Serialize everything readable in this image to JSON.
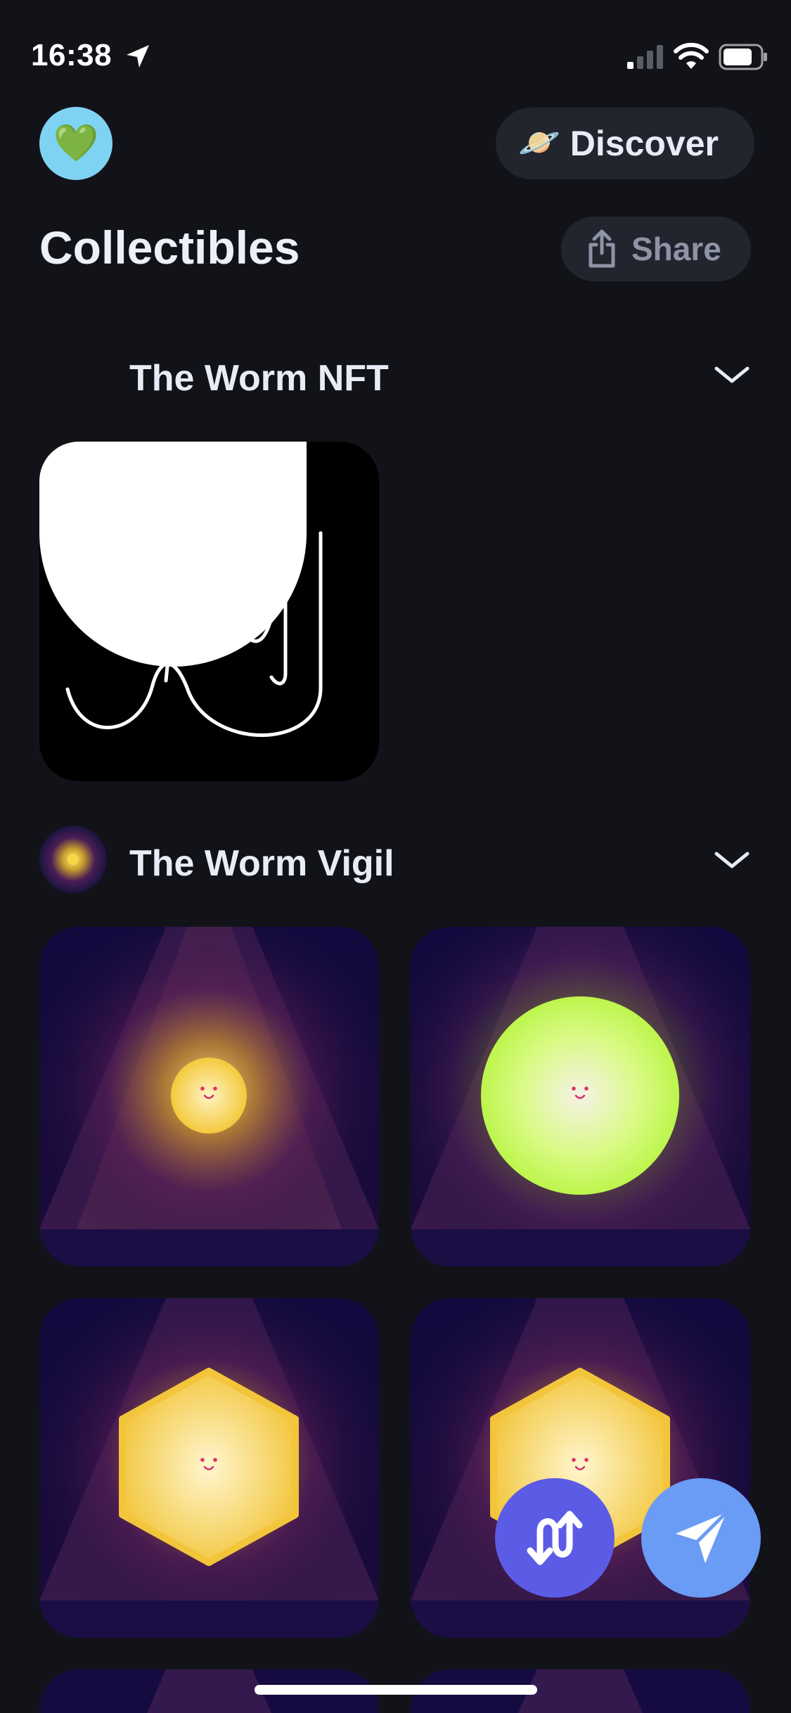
{
  "status_bar": {
    "time": "16:38",
    "icons": [
      "location-arrow-icon",
      "cellular-signal-icon",
      "wifi-icon",
      "battery-icon"
    ]
  },
  "header": {
    "avatar_emoji": "💚",
    "discover_emoji": "🪐",
    "discover_label": "Discover",
    "title": "Collectibles",
    "share_label": "Share"
  },
  "collections": [
    {
      "title": "The Worm NFT",
      "items": [
        "worm-line-art"
      ]
    },
    {
      "title": "The Worm Vigil",
      "items": [
        "small-yellow-orb",
        "large-green-orb",
        "yellow-hexagon",
        "yellow-hexagon"
      ]
    }
  ],
  "fabs": [
    "swap-icon",
    "send-icon"
  ],
  "colors": {
    "background": "#121318",
    "button_bg": "#22252D",
    "avatar_bg": "#7FD3F2",
    "swap_fab": "#5B5BE6",
    "send_fab": "#6A9BF5"
  }
}
